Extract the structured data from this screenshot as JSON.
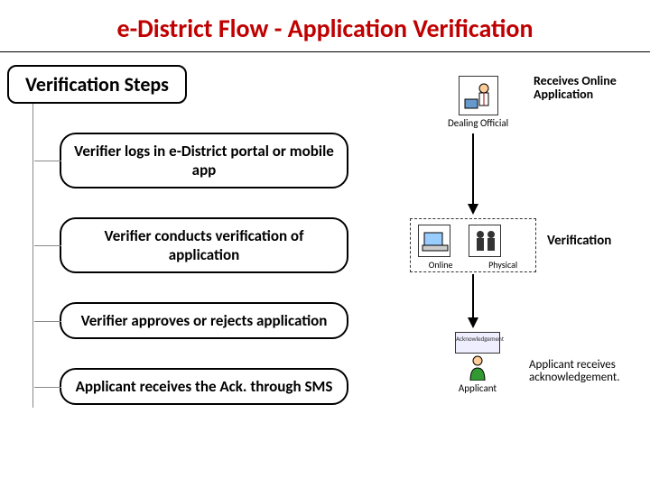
{
  "title": "e-District Flow - Application Verification",
  "steps_header": "Verification Steps",
  "steps": [
    "Verifier logs in e-District portal or mobile app",
    "Verifier conducts verification of application",
    "Verifier approves or rejects application",
    "Applicant receives the Ack. through SMS"
  ],
  "diagram": {
    "official_caption": "Dealing Official",
    "receives_label": "Receives Online Application",
    "verification_label": "Verification",
    "verif_modes": {
      "online": "Online",
      "physical": "Physical"
    },
    "ack_box": "Acknowledgement",
    "applicant_caption": "Applicant",
    "applicant_receives": "Applicant receives acknowledgement."
  }
}
